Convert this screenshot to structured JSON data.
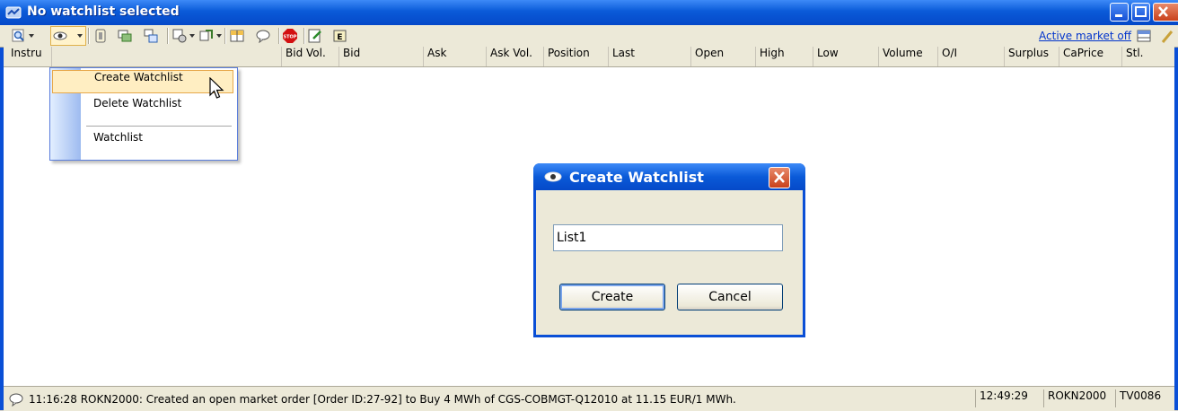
{
  "window": {
    "title": "No watchlist selected"
  },
  "toolbar": {
    "active_market_link": "Active market off",
    "icons": [
      "magnify-icon",
      "eye-icon",
      "book-icon",
      "chart-icon",
      "transfer-icon",
      "gear-icon",
      "copy-icon",
      "layout-icon",
      "chat-icon",
      "stop-icon",
      "notes-icon",
      "e-icon",
      "grid-icon",
      "pin-icon"
    ]
  },
  "columns": [
    "Instru",
    "Bid Vol.",
    "Bid",
    "Ask",
    "Ask Vol.",
    "Position",
    "Last",
    "Open",
    "High",
    "Low",
    "Volume",
    "O/I",
    "Surplus",
    "CaPrice",
    "Stl."
  ],
  "menu": {
    "items": [
      "Create Watchlist",
      "Delete Watchlist",
      "Watchlist"
    ],
    "highlighted": "Create Watchlist"
  },
  "dialog": {
    "title": "Create Watchlist",
    "input_value": "List1",
    "create_label": "Create",
    "cancel_label": "Cancel"
  },
  "status": {
    "message": "11:16:28  ROKN2000: Created an open market order [Order ID:27-92] to Buy 4 MWh of CGS-COBMGT-Q12010 at 11.15 EUR/1 MWh.",
    "time": "12:49:29",
    "user": "ROKN2000",
    "terminal": "TV0086"
  },
  "colors": {
    "title_blue": "#0a5ad8",
    "menu_highlight": "#ffeec2",
    "link": "#0033cc"
  }
}
